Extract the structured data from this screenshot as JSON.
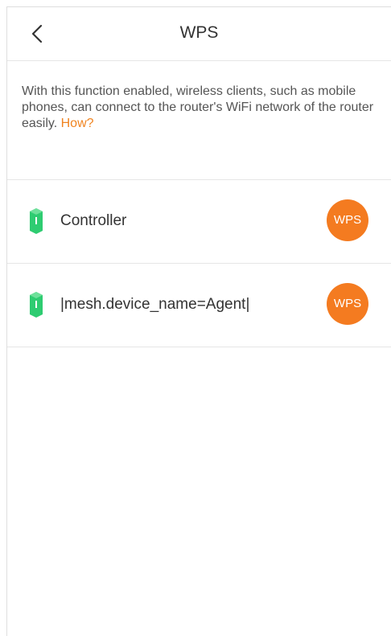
{
  "header": {
    "title": "WPS",
    "back_icon": "chevron-left-icon"
  },
  "description": {
    "text": "With this function enabled, wireless clients, such as mobile phones, can connect to the router's WiFi network of the router easily.",
    "link_label": "How?"
  },
  "devices": [
    {
      "name": "Controller",
      "icon": "mesh-node-icon",
      "button_label": "WPS"
    },
    {
      "name": "|mesh.device_name=Agent|",
      "icon": "mesh-node-icon",
      "button_label": "WPS"
    }
  ],
  "colors": {
    "accent": "#f47b20",
    "link": "#f0831f",
    "device_icon": "#2ecc71"
  }
}
